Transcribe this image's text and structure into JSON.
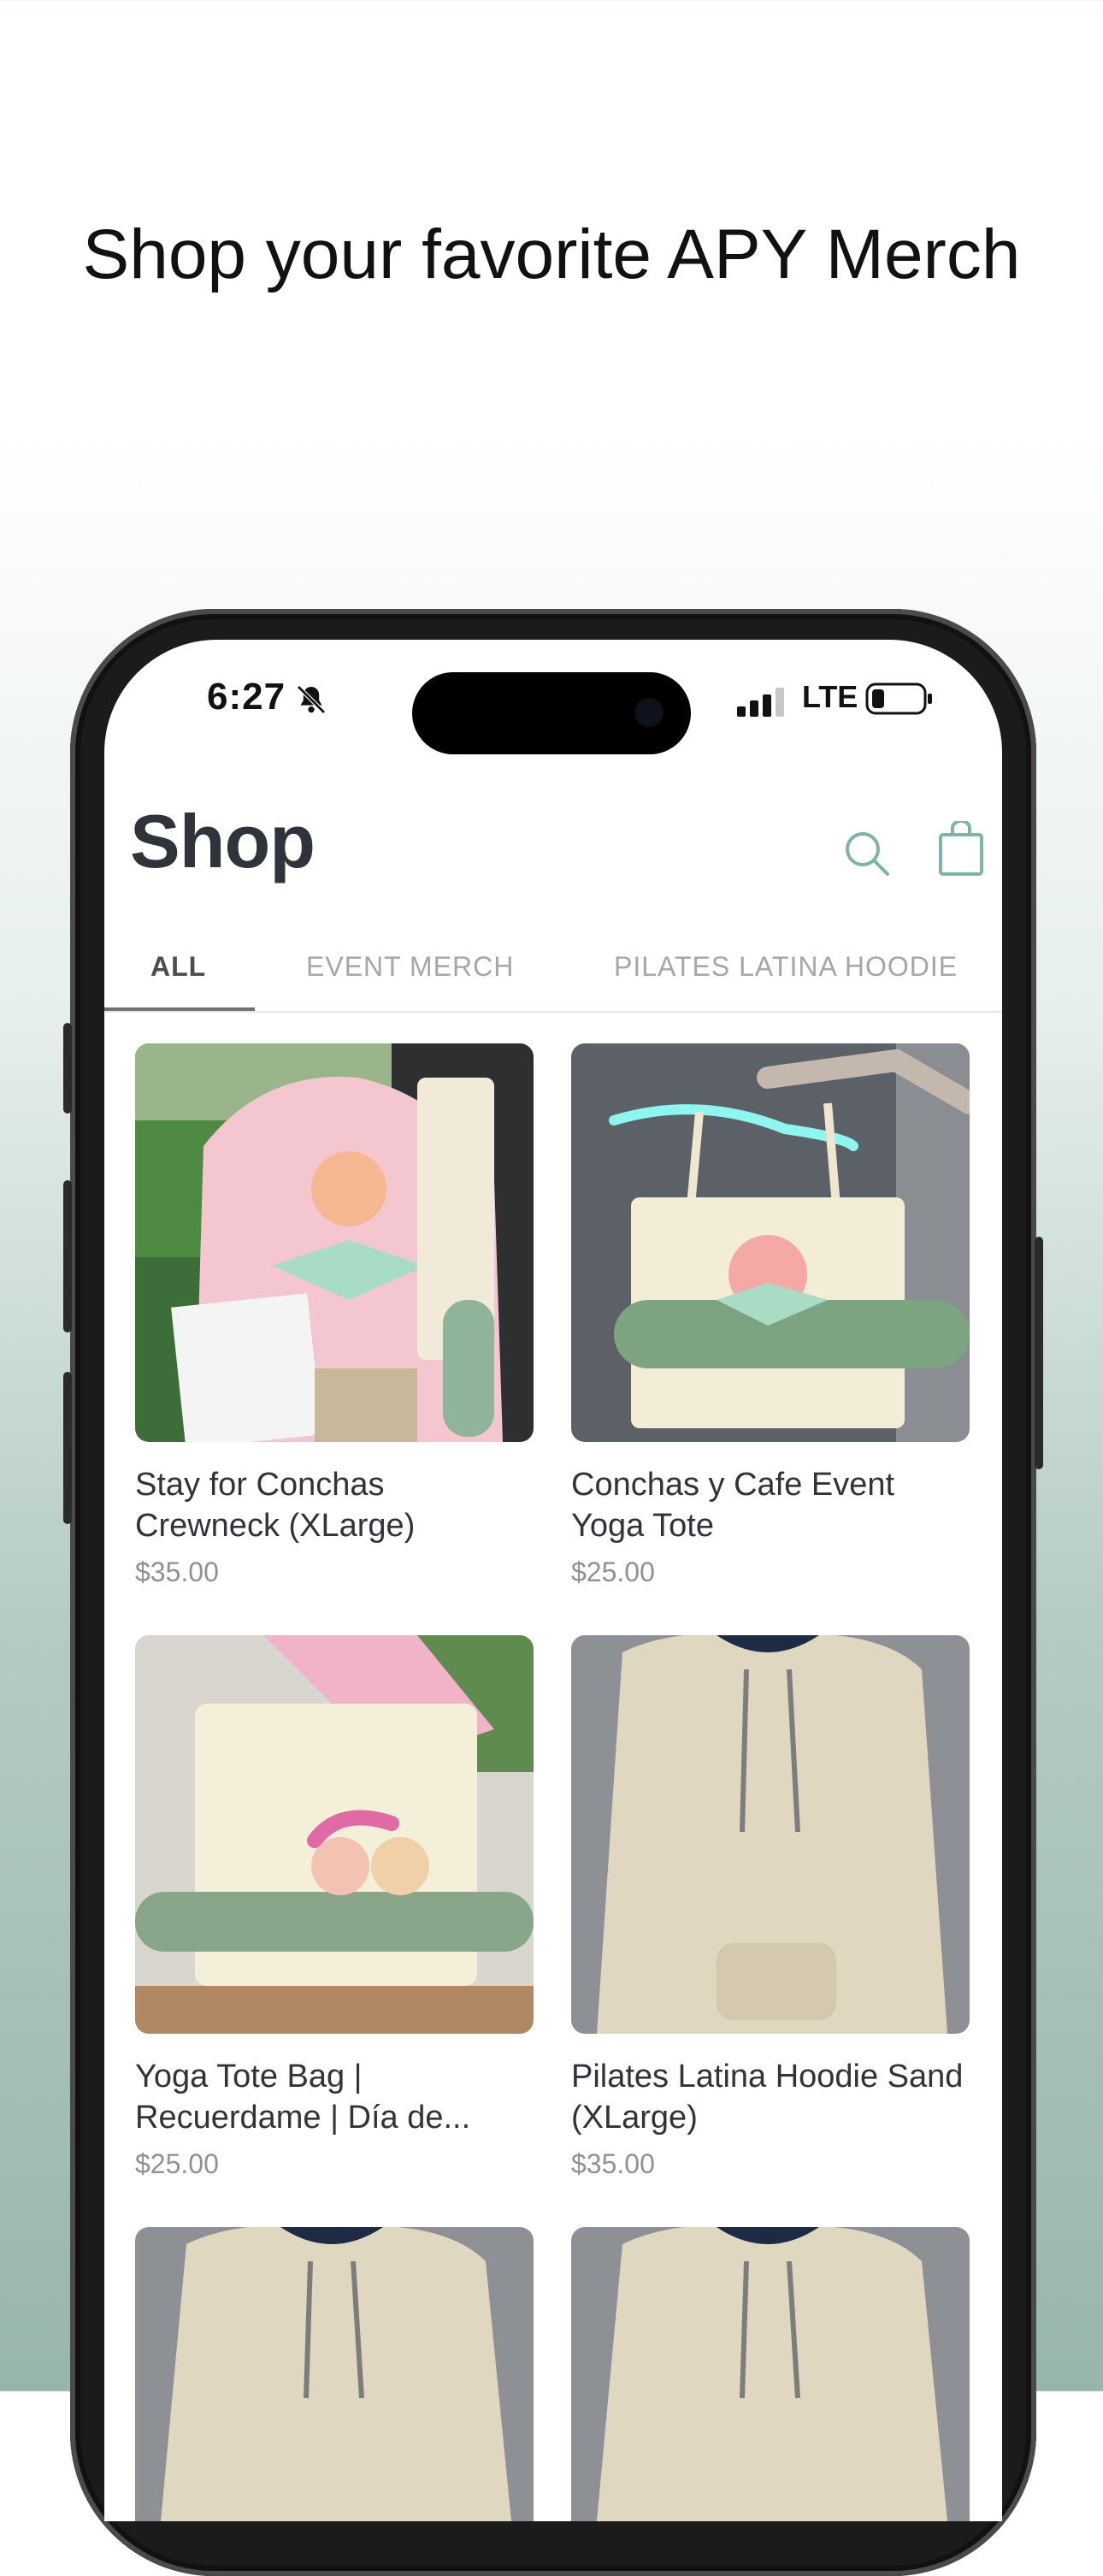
{
  "headline": "Shop your favorite APY Merch",
  "status_bar": {
    "time": "6:27",
    "network": "LTE"
  },
  "page": {
    "title": "Shop"
  },
  "tabs": [
    {
      "label": "ALL"
    },
    {
      "label": "EVENT MERCH"
    },
    {
      "label": "PILATES LATINA HOODIE"
    }
  ],
  "products": [
    {
      "name": "Stay for Conchas Crewneck (XLarge)",
      "price": "$35.00"
    },
    {
      "name": "Conchas y Cafe Event Yoga Tote",
      "price": "$25.00"
    },
    {
      "name": "Yoga Tote Bag | Recuerdame | Día de...",
      "price": "$25.00"
    },
    {
      "name": "Pilates Latina Hoodie Sand (XLarge)",
      "price": "$35.00"
    }
  ],
  "colors": {
    "accent": "#7fb3a3",
    "title": "#2f343a",
    "muted": "#a4a6a8"
  },
  "icons": [
    "bell-slash-icon",
    "signal-icon",
    "battery-icon",
    "search-icon",
    "shopping-bag-icon"
  ]
}
